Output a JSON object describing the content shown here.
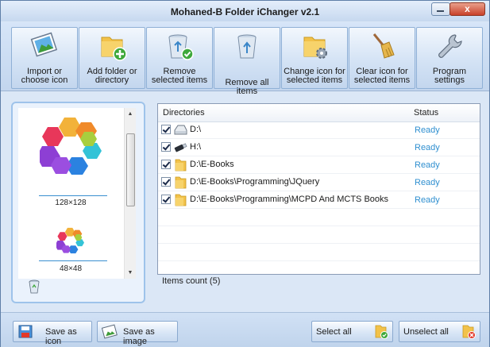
{
  "window": {
    "title": "Mohaned-B Folder iChanger v2.1",
    "close_label": "x"
  },
  "toolbar": [
    {
      "label": "Import or choose icon",
      "icon": "image-import-icon"
    },
    {
      "label": "Add folder or directory",
      "icon": "folder-add-icon"
    },
    {
      "label": "Remove selected items",
      "icon": "recycle-bin-check-icon"
    },
    {
      "label": "Remove all items",
      "icon": "recycle-bin-icon"
    },
    {
      "label": "Change icon for selected items",
      "icon": "folder-gear-icon"
    },
    {
      "label": "Clear icon for selected items",
      "icon": "broom-icon"
    },
    {
      "label": "Program settings",
      "icon": "wrench-icon"
    }
  ],
  "preview": {
    "sizes": [
      "128×128",
      "48×48"
    ],
    "icon": "hexagon-cluster-icon"
  },
  "list": {
    "headers": {
      "directories": "Directories",
      "status": "Status"
    },
    "rows": [
      {
        "path": "D:\\",
        "status": "Ready",
        "checked": true,
        "icon": "drive-icon"
      },
      {
        "path": "H:\\",
        "status": "Ready",
        "checked": true,
        "icon": "usb-drive-icon"
      },
      {
        "path": "D:\\E-Books",
        "status": "Ready",
        "checked": true,
        "icon": "folder-icon"
      },
      {
        "path": "D:\\E-Books\\Programming\\JQuery",
        "status": "Ready",
        "checked": true,
        "icon": "folder-icon"
      },
      {
        "path": "D:\\E-Books\\Programming\\MCPD And MCTS Books",
        "status": "Ready",
        "checked": true,
        "icon": "folder-icon"
      }
    ],
    "count_text": "Items count (5)"
  },
  "bottom": {
    "save_icon": "Save as icon",
    "save_image": "Save as image",
    "select_all": "Select all",
    "unselect_all": "Unselect all"
  },
  "colors": {
    "accent": "#2f8fd0",
    "status_ready": "#2f8fd0",
    "close_red": "#c9412a"
  }
}
